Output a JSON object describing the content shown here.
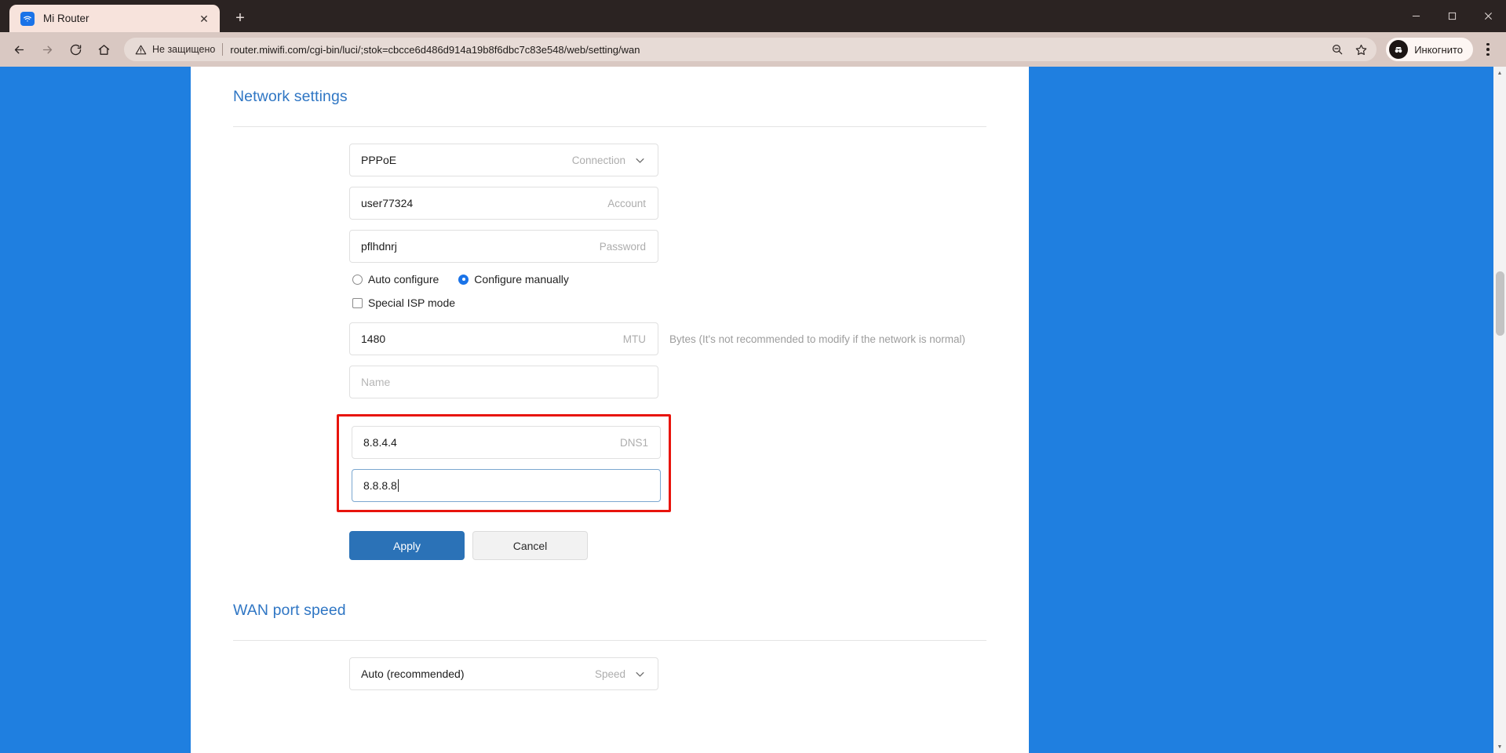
{
  "browser": {
    "tab": {
      "title": "Mi Router",
      "favicon_name": "wifi-icon",
      "close_label": "✕"
    },
    "new_tab_label": "+",
    "window_controls": {
      "minimize": "—",
      "maximize": "□",
      "close": "✕"
    },
    "nav": {
      "back": "←",
      "forward": "→",
      "reload": "⟳",
      "home": "⌂"
    },
    "omnibox": {
      "security_text": "Не защищено",
      "url": "router.miwifi.com/cgi-bin/luci/;stok=cbcce6d486d914a19b8f6dbc7c83e548/web/setting/wan",
      "zoom_icon": "search-minus-icon",
      "bookmark_icon": "star-icon"
    },
    "profile": {
      "label": "Инкогнито",
      "avatar_icon": "incognito-icon"
    },
    "menu_icon": "three-dots-icon"
  },
  "page": {
    "network_settings": {
      "heading": "Network settings",
      "fields": [
        {
          "value": "PPPoE",
          "label": "Connection",
          "has_chevron": true,
          "placeholder": false,
          "focused": false
        },
        {
          "value": "user77324",
          "label": "Account",
          "has_chevron": false,
          "placeholder": false,
          "focused": false
        },
        {
          "value": "pflhdnrj",
          "label": "Password",
          "has_chevron": false,
          "placeholder": false,
          "focused": false
        }
      ],
      "radios": [
        {
          "label": "Auto configure",
          "checked": false
        },
        {
          "label": "Configure manually",
          "checked": true
        }
      ],
      "checkbox": {
        "label": "Special ISP mode",
        "checked": false
      },
      "mtu": {
        "value": "1480",
        "label": "MTU",
        "hint": "Bytes (It's not recommended to modify if the network is normal)"
      },
      "name_field": {
        "value": "Name",
        "label": "",
        "placeholder": true
      },
      "dns_fields": [
        {
          "value": "8.8.4.4",
          "label": "DNS1",
          "focused": false
        },
        {
          "value": "8.8.8.8",
          "label": "",
          "focused": true
        }
      ],
      "highlight_color": "#e8140c",
      "buttons": {
        "apply": "Apply",
        "cancel": "Cancel"
      }
    },
    "wan_port_speed": {
      "heading": "WAN port speed",
      "field": {
        "value": "Auto (recommended)",
        "label": "Speed"
      }
    }
  },
  "colors": {
    "accent_blue": "#2f76c4",
    "button_blue": "#2b72b7",
    "page_backdrop": "#1f7fe0",
    "annotation_red": "#e8140c"
  }
}
